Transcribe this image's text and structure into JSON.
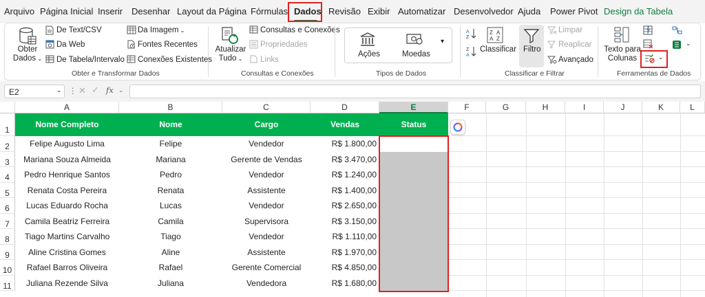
{
  "tabs": [
    {
      "label": "Arquivo"
    },
    {
      "label": "Página Inicial"
    },
    {
      "label": "Inserir"
    },
    {
      "label": "Desenhar"
    },
    {
      "label": "Layout da Página"
    },
    {
      "label": "Fórmulas"
    },
    {
      "label": "Dados"
    },
    {
      "label": "Revisão"
    },
    {
      "label": "Exibir"
    },
    {
      "label": "Automatizar"
    },
    {
      "label": "Desenvolvedor"
    },
    {
      "label": "Ajuda"
    },
    {
      "label": "Power Pivot"
    },
    {
      "label": "Design da Tabela"
    }
  ],
  "active_tab": "Dados",
  "ribbon": {
    "obter": {
      "obter_dados_1": "Obter",
      "obter_dados_2": "Dados",
      "de_text_csv": "De Text/CSV",
      "da_web": "Da Web",
      "de_tabela": "De Tabela/Intervalo",
      "da_imagem": "Da Imagem",
      "fontes_recentes": "Fontes Recentes",
      "conexoes_existentes": "Conexões Existentes",
      "group_label": "Obter e Transformar Dados"
    },
    "consultas": {
      "atualizar_1": "Atualizar",
      "atualizar_2": "Tudo",
      "consultas_conexoes": "Consultas e Conexões",
      "propriedades": "Propriedades",
      "links": "Links",
      "group_label": "Consultas e Conexões"
    },
    "tipos": {
      "acoes": "Ações",
      "moedas": "Moedas",
      "group_label": "Tipos de Dados"
    },
    "classificar": {
      "classificar": "Classificar",
      "filtro": "Filtro",
      "limpar": "Limpar",
      "reaplicar": "Reaplicar",
      "avancado": "Avançado",
      "group_label": "Classificar e Filtrar"
    },
    "ferramentas": {
      "texto_colunas_1": "Texto para",
      "texto_colunas_2": "Colunas",
      "group_label": "Ferramentas de Dados"
    }
  },
  "formula_bar": {
    "name_box": "E2",
    "fx": "fx",
    "value": ""
  },
  "columns": [
    "A",
    "B",
    "C",
    "D",
    "E",
    "F",
    "G",
    "H",
    "I",
    "J",
    "K",
    "L"
  ],
  "rows": [
    "1",
    "2",
    "3",
    "4",
    "5",
    "6",
    "7",
    "8",
    "9",
    "10",
    "11"
  ],
  "table": {
    "headers": [
      "Nome Completo",
      "Nome",
      "Cargo",
      "Vendas",
      "Status"
    ],
    "rows": [
      [
        "Felipe Augusto Lima",
        "Felipe",
        "Vendedor",
        "R$ 1.800,00",
        ""
      ],
      [
        "Mariana Souza Almeida",
        "Mariana",
        "Gerente de Vendas",
        "R$ 3.470,00",
        ""
      ],
      [
        "Pedro Henrique Santos",
        "Pedro",
        "Vendedor",
        "R$ 1.240,00",
        ""
      ],
      [
        "Renata Costa Pereira",
        "Renata",
        "Assistente",
        "R$ 1.400,00",
        ""
      ],
      [
        "Lucas Eduardo Rocha",
        "Lucas",
        "Vendedor",
        "R$ 2.650,00",
        ""
      ],
      [
        "Camila Beatriz Ferreira",
        "Camila",
        "Supervisora",
        "R$ 3.150,00",
        ""
      ],
      [
        "Tiago Martins Carvalho",
        "Tiago",
        "Vendedor",
        "R$ 1.110,00",
        ""
      ],
      [
        "Aline Cristina Gomes",
        "Aline",
        "Assistente",
        "R$ 1.970,00",
        ""
      ],
      [
        "Rafael Barros Oliveira",
        "Rafael",
        "Gerente Comercial",
        "R$ 4.850,00",
        ""
      ],
      [
        "Juliana Rezende Silva",
        "Juliana",
        "Vendedora",
        "R$ 1.680,00",
        ""
      ]
    ]
  },
  "colors": {
    "header_green": "#00b050",
    "excel_green": "#107c41",
    "highlight_red": "#e0201f",
    "selection_gray": "#c8c8c8"
  },
  "icons": {
    "database": "database-icon",
    "text_file": "text-file-icon",
    "web": "web-icon",
    "table": "table-icon",
    "image": "image-icon",
    "recent": "recent-sources-icon",
    "connections": "connections-icon",
    "refresh": "refresh-icon",
    "bank": "bank-icon",
    "money": "money-icon",
    "sort_az": "sort-az-icon",
    "sort_za": "sort-za-icon",
    "filter": "filter-icon",
    "data_validation": "data-validation-icon",
    "copilot": "copilot-icon"
  }
}
